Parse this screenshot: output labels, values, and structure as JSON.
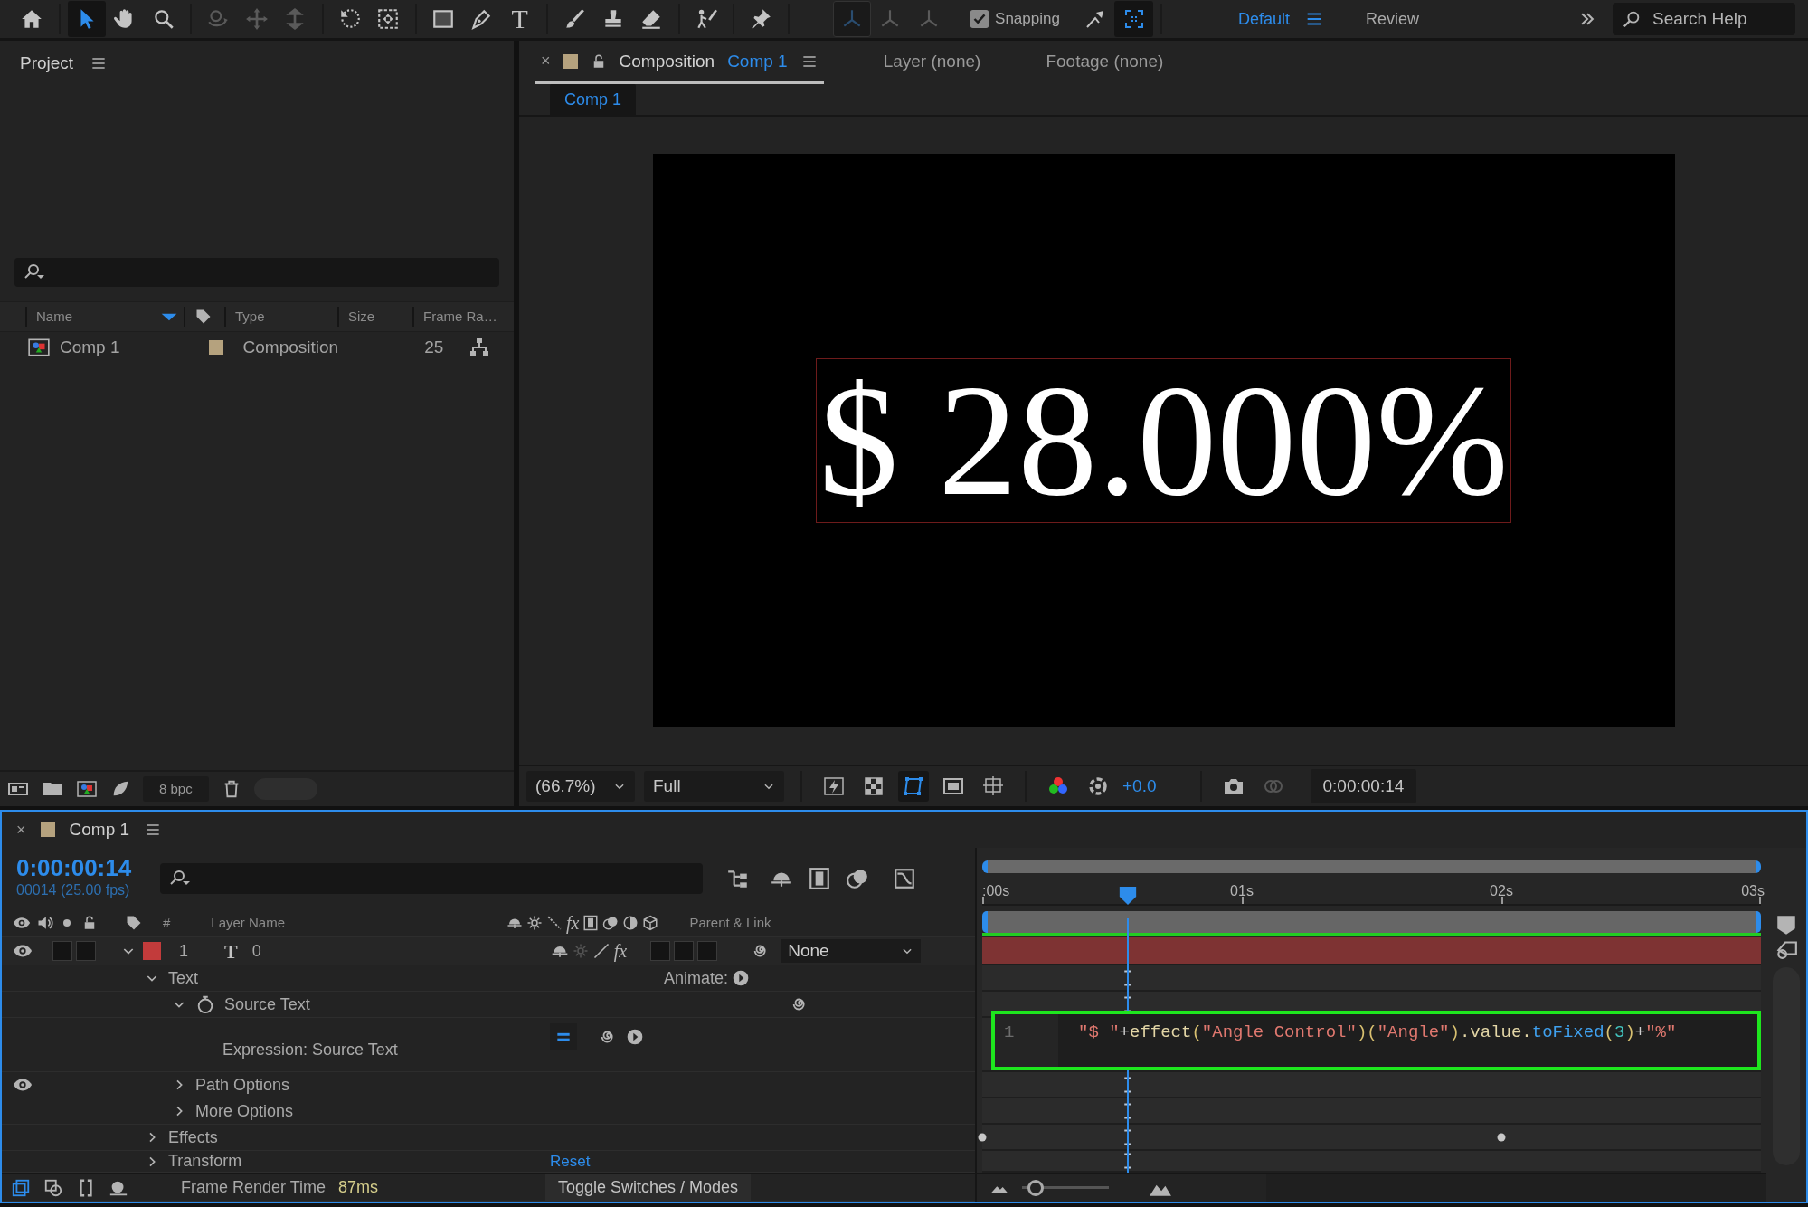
{
  "toolbar": {
    "tools": [
      {
        "kind": "home",
        "selected": false,
        "disabled": false
      },
      {
        "kind": "select",
        "selected": true,
        "disabled": false
      },
      {
        "kind": "hand",
        "selected": false,
        "disabled": false
      },
      {
        "kind": "zoom",
        "selected": false,
        "disabled": false
      },
      {
        "kind": "orbit",
        "selected": false,
        "disabled": true
      },
      {
        "kind": "pan",
        "selected": false,
        "disabled": true
      },
      {
        "kind": "dolly",
        "selected": false,
        "disabled": true
      },
      {
        "kind": "rotate",
        "selected": false,
        "disabled": false
      },
      {
        "kind": "track",
        "selected": false,
        "disabled": false
      },
      {
        "kind": "rectangle",
        "selected": false,
        "disabled": false
      },
      {
        "kind": "pen",
        "selected": false,
        "disabled": false
      },
      {
        "kind": "type",
        "glyph": "T",
        "selected": false,
        "disabled": false
      },
      {
        "kind": "brush",
        "selected": false,
        "disabled": false
      },
      {
        "kind": "stamp",
        "selected": false,
        "disabled": false
      },
      {
        "kind": "eraser",
        "selected": false,
        "disabled": false
      },
      {
        "kind": "roto",
        "selected": false,
        "disabled": false
      },
      {
        "kind": "pin",
        "selected": false,
        "disabled": false
      },
      {
        "kind": "axis",
        "selected": true,
        "disabled": true
      },
      {
        "kind": "axis",
        "selected": false,
        "disabled": true
      },
      {
        "kind": "axis",
        "selected": false,
        "disabled": true
      }
    ],
    "snapping": {
      "label": "Snapping",
      "checked": true
    },
    "snap_tools": [
      {
        "kind": "edges",
        "selected": false
      },
      {
        "kind": "frame",
        "selected": true
      }
    ],
    "workspaces": [
      {
        "label": "Default",
        "selected": true
      },
      {
        "label": "Review",
        "selected": false
      }
    ],
    "search": {
      "placeholder": "Search Help"
    }
  },
  "project": {
    "title": "Project",
    "columns": [
      {
        "kind": "name",
        "label": "Name",
        "sorted": true
      },
      {
        "kind": "label"
      },
      {
        "kind": "type",
        "label": "Type",
        "sorted": false
      },
      {
        "kind": "size",
        "label": "Size",
        "sorted": false
      },
      {
        "kind": "rate",
        "label": "Frame Ra…",
        "sorted": false
      }
    ],
    "items": [
      {
        "name": "Comp 1",
        "color": "#b5a27e",
        "type": "Composition",
        "frame_rate": "25"
      }
    ],
    "bit_depth": "8 bpc"
  },
  "composition": {
    "tabs": [
      {
        "kind": "composition",
        "close": "×",
        "color": "#b5a27e",
        "label": "Composition",
        "name": "Comp 1",
        "selected": true
      },
      {
        "kind": "layer",
        "label": "Layer (none)",
        "selected": false
      },
      {
        "kind": "footage",
        "label": "Footage (none)",
        "selected": false
      }
    ],
    "breadcrumb": "Comp 1",
    "viewer_text": "$ 28.000%",
    "zoom": "(66.7%)",
    "resolution": "Full",
    "exposure": "+0.0",
    "timecode": "0:00:00:14"
  },
  "timeline": {
    "tab": {
      "close": "×",
      "color": "#b5a27e",
      "label": "Comp 1"
    },
    "current_time": "0:00:00:14",
    "frame_info": "00014 (25.00 fps)",
    "columns": {
      "number": "#",
      "layer_name": "Layer Name",
      "fx": "fx",
      "parent": "Parent & Link"
    },
    "layers": [
      {
        "number": "1",
        "type_glyph": "T",
        "name": "0",
        "fx": "fx",
        "color": "#c23b3b",
        "fx_enabled": true,
        "visible": true,
        "expanded": true,
        "parent": "None"
      }
    ],
    "properties": [
      {
        "kind": "group",
        "label": "Text",
        "expanded": true,
        "visible": false,
        "extra": "Animate:",
        "children": [
          {
            "kind": "property",
            "label": "Source Text",
            "expanded": true,
            "visible": false,
            "children": [
              {
                "kind": "expression",
                "label": "Expression: Source Text",
                "visible": false,
                "enabled": true
              }
            ]
          },
          {
            "kind": "group",
            "label": "Path Options",
            "expanded": false,
            "visible": true
          },
          {
            "kind": "group",
            "label": "More Options",
            "expanded": false,
            "visible": false
          }
        ]
      },
      {
        "kind": "group",
        "label": "Effects",
        "expanded": false,
        "visible": false
      },
      {
        "kind": "group",
        "label": "Transform",
        "expanded": false,
        "visible": false,
        "extra": "Reset"
      }
    ],
    "ruler": [
      ":00s",
      "01s",
      "02s",
      "03s"
    ],
    "playhead": {
      "level": 0.187
    },
    "expression": {
      "line_number": "1",
      "tokens": [
        {
          "kind": "string",
          "text": "\"$ \""
        },
        {
          "kind": "op",
          "text": "+"
        },
        {
          "kind": "ident",
          "text": "effect"
        },
        {
          "kind": "paren",
          "text": "("
        },
        {
          "kind": "string",
          "text": "\"Angle Control\""
        },
        {
          "kind": "paren",
          "text": ")("
        },
        {
          "kind": "string",
          "text": "\"Angle\""
        },
        {
          "kind": "paren",
          "text": ")"
        },
        {
          "kind": "ident",
          "text": ".value."
        },
        {
          "kind": "method",
          "text": "toFixed"
        },
        {
          "kind": "paren",
          "text": "("
        },
        {
          "kind": "number",
          "text": "3"
        },
        {
          "kind": "paren",
          "text": ")"
        },
        {
          "kind": "op",
          "text": "+"
        },
        {
          "kind": "string",
          "text": "\"%\""
        }
      ]
    },
    "zoom_slider": {
      "level": 0.08
    },
    "footer": {
      "render_label": "Frame Render Time",
      "render_time": "87ms",
      "toggle": "Toggle Switches / Modes"
    }
  }
}
